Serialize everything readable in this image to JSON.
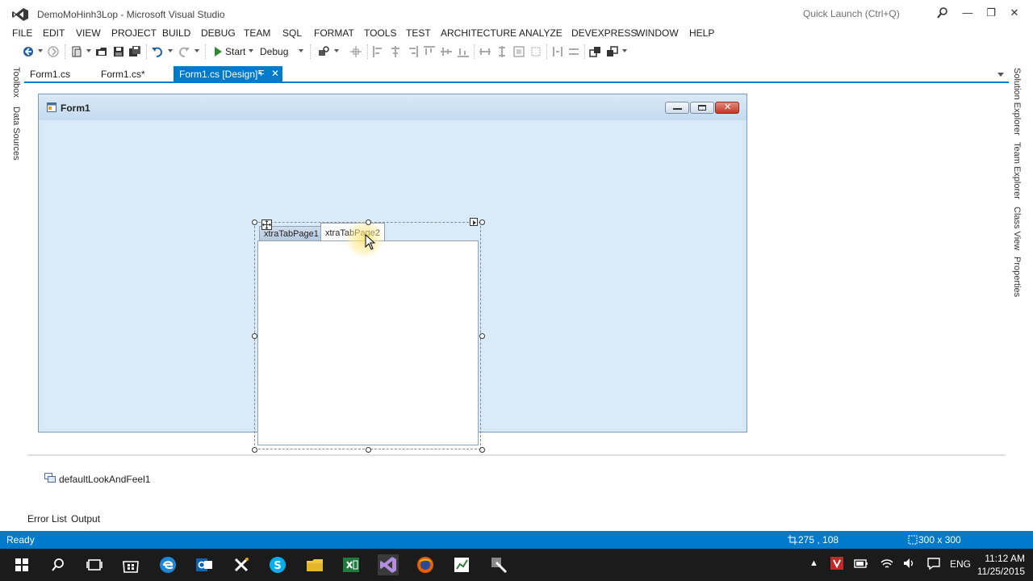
{
  "window": {
    "title": "DemoMoHinh3Lop - Microsoft Visual Studio",
    "quick_launch": "Quick Launch (Ctrl+Q)"
  },
  "menu": [
    "FILE",
    "EDIT",
    "VIEW",
    "PROJECT",
    "BUILD",
    "DEBUG",
    "TEAM",
    "SQL",
    "FORMAT",
    "TOOLS",
    "TEST",
    "ARCHITECTURE",
    "ANALYZE",
    "DEVEXPRESS",
    "WINDOW",
    "HELP"
  ],
  "toolbar": {
    "start_label": "Start",
    "config_label": "Debug"
  },
  "left_panels": [
    "Toolbox",
    "Data Sources"
  ],
  "right_panels": [
    "Solution Explorer",
    "Team Explorer",
    "Class View",
    "Properties"
  ],
  "document_tabs": [
    "Form1.cs",
    "Form1.cs*",
    "Form1.cs [Design]*"
  ],
  "designer": {
    "form_title": "Form1",
    "tab_pages": [
      "xtraTabPage1",
      "xtraTabPage2"
    ]
  },
  "component_tray": {
    "item": "defaultLookAndFeel1"
  },
  "bottom_panels": [
    "Error List",
    "Output"
  ],
  "status": {
    "text": "Ready",
    "position": "275 , 108",
    "size": "300 x 300"
  },
  "taskbar": {
    "language": "ENG",
    "time": "11:12 AM",
    "date": "11/25/2015"
  },
  "colors": {
    "accent": "#007acc",
    "form_background": "#d6e8f6",
    "taskbar": "#1b1b1b"
  }
}
